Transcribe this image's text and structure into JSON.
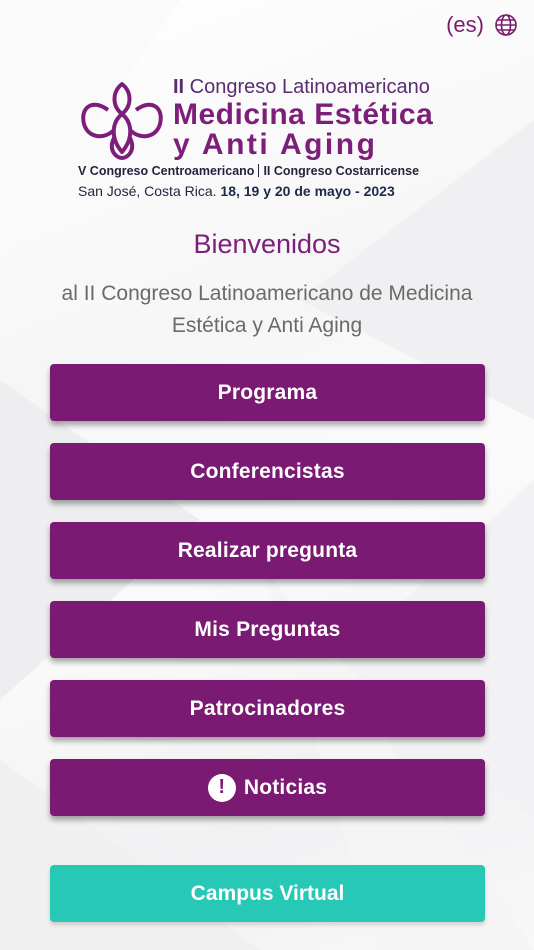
{
  "language": {
    "code": "(es)",
    "icon": "globe-icon"
  },
  "logo": {
    "line1_prefix": "II",
    "line1_rest": " Congreso Latinoamericano",
    "line2": "Medicina Estética",
    "line3": "y Anti Aging",
    "line4_left": "V Congreso Centroamericano",
    "line4_right": "II Congreso Costarricense",
    "line5_place": "San José, Costa Rica.",
    "line5_dates": "18, 19 y 20 de mayo - 2023",
    "icon": "orchid-logo-icon"
  },
  "welcome": {
    "title": "Bienvenidos",
    "subtitle": "al II Congreso Latinoamericano de Medicina Estética y Anti Aging"
  },
  "menu": {
    "programa": "Programa",
    "conferencistas": "Conferencistas",
    "realizar_pregunta": "Realizar pregunta",
    "mis_preguntas": "Mis Preguntas",
    "patrocinadores": "Patrocinadores",
    "noticias": "Noticias",
    "noticias_icon": "alert-circle-icon",
    "alert_glyph": "!"
  },
  "campus": {
    "label": "Campus Virtual"
  },
  "colors": {
    "primary": "#7a1a73",
    "accent": "#27c9b6",
    "title": "#7d1e7a",
    "text": "#6a6a6a"
  }
}
